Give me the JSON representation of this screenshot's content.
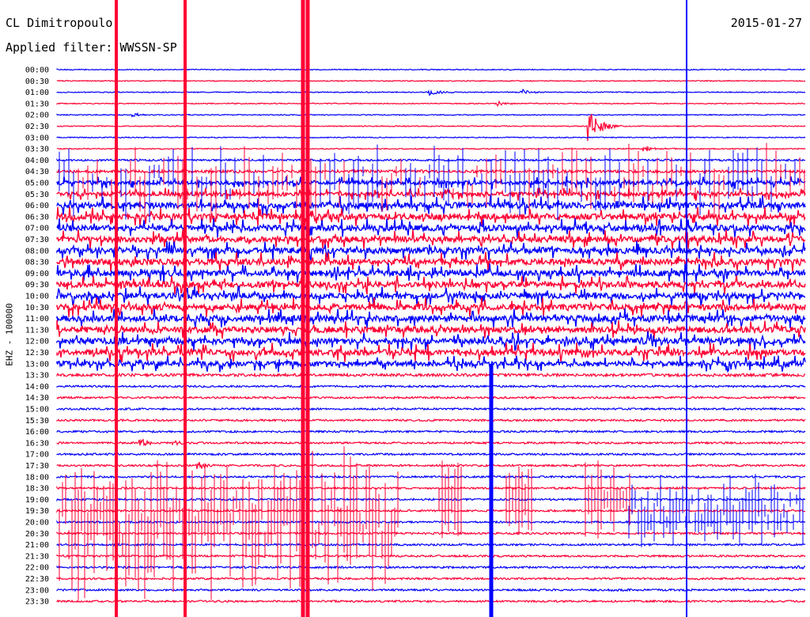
{
  "header": {
    "station": "CL Dimitropoulo",
    "date": "2015-01-27",
    "filter": "Applied filter: WWSSN-SP",
    "channel": "EHZ - 100000"
  },
  "colors": {
    "trace_a": "#0000ff",
    "trace_b": "#ff0033"
  },
  "chart_data": {
    "type": "line",
    "title": "",
    "ylabel": "EHZ - 100000",
    "y_tick_labels": [
      "00:00",
      "00:30",
      "01:00",
      "01:30",
      "02:00",
      "02:30",
      "03:00",
      "03:30",
      "04:00",
      "04:30",
      "05:00",
      "05:30",
      "06:00",
      "06:30",
      "07:00",
      "07:30",
      "08:00",
      "08:30",
      "09:00",
      "09:30",
      "10:00",
      "10:30",
      "11:00",
      "11:30",
      "12:00",
      "12:30",
      "13:00",
      "13:30",
      "14:00",
      "14:30",
      "15:00",
      "15:30",
      "16:00",
      "16:30",
      "17:00",
      "17:30",
      "18:00",
      "18:30",
      "19:00",
      "19:30",
      "20:00",
      "20:30",
      "21:00",
      "21:30",
      "22:00",
      "22:30",
      "23:00",
      "23:30"
    ],
    "x_minutes_per_row": 30,
    "row_colors_alternate": [
      "#0000ff",
      "#ff0033"
    ],
    "noise_level_by_row": [
      1,
      1,
      1,
      1,
      1,
      1,
      1,
      1,
      2,
      3,
      4,
      4,
      6,
      6,
      6,
      6,
      6,
      6,
      6,
      6,
      6,
      6,
      6,
      6,
      6,
      6,
      5,
      3,
      2,
      2,
      2,
      2,
      2,
      2,
      2,
      2,
      2,
      2,
      2,
      2,
      2,
      2,
      2,
      2,
      2,
      2,
      2,
      2
    ],
    "events": [
      {
        "row": 2,
        "t": 14.9,
        "amp": 5
      },
      {
        "row": 2,
        "t": 18.6,
        "amp": 4
      },
      {
        "row": 3,
        "t": 17.6,
        "amp": 4
      },
      {
        "row": 4,
        "t": 3.0,
        "amp": 3
      },
      {
        "row": 5,
        "t": 21.3,
        "amp": 24
      },
      {
        "row": 7,
        "t": 23.5,
        "amp": 4
      },
      {
        "row": 33,
        "t": 3.3,
        "amp": 5
      },
      {
        "row": 33,
        "t": 4.6,
        "amp": 3
      },
      {
        "row": 35,
        "t": 5.6,
        "amp": 5
      },
      {
        "row": 44,
        "t": 29.5,
        "amp": 3
      },
      {
        "row": 46,
        "t": 22.1,
        "amp": 3
      }
    ],
    "glitch_columns_x": [
      147,
      234,
      383,
      389
    ],
    "blue_line_columns_x": [
      621,
      868
    ]
  }
}
